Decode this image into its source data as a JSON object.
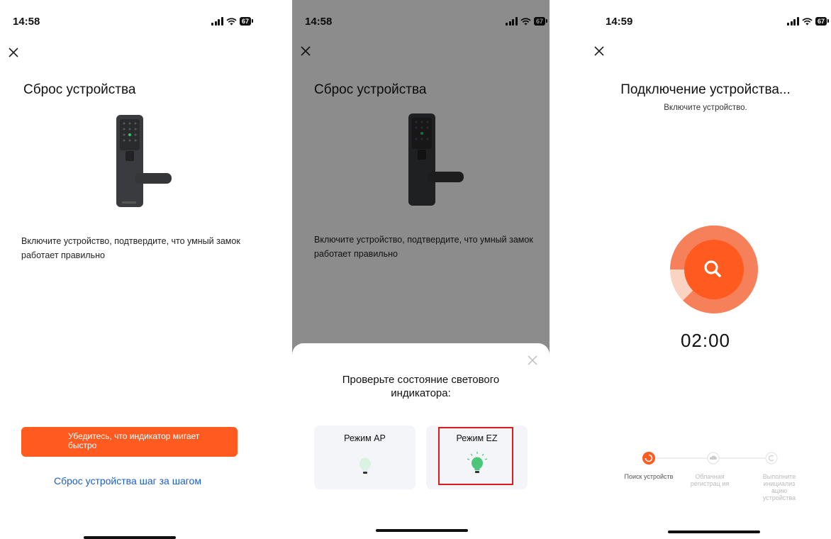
{
  "screens": [
    {
      "status": {
        "time": "14:58",
        "battery": "67"
      },
      "title": "Сброс устройства",
      "description": "Включите устройство, подтвердите, что умный замок работает правильно",
      "primary_button": "Убедитесь, что индикатор мигает быстро",
      "link": "Сброс устройства шаг за шагом"
    },
    {
      "status": {
        "time": "14:58",
        "battery": "67"
      },
      "title": "Сброс устройства",
      "description": "Включите устройство, подтвердите, что умный замок работает правильно",
      "sheet": {
        "title": "Проверьте состояние светового индикатора:",
        "modes": [
          {
            "label": "Режим AP",
            "selected": false
          },
          {
            "label": "Режим EZ",
            "selected": true
          }
        ]
      }
    },
    {
      "status": {
        "time": "14:59",
        "battery": "67"
      },
      "title": "Подключение устройства...",
      "subtitle": "Включите устройство.",
      "timer": "02:00",
      "steps": [
        {
          "label": "Поиск устройств",
          "active": true
        },
        {
          "label": "Облачная регистрац ия",
          "active": false
        },
        {
          "label": "Выполните инициализ ацию устройства",
          "active": false
        }
      ]
    }
  ],
  "colors": {
    "accent": "#ff5a1f",
    "link": "#1a5fd0",
    "highlight": "#d91c1c",
    "indicator": "#4cc77a"
  }
}
